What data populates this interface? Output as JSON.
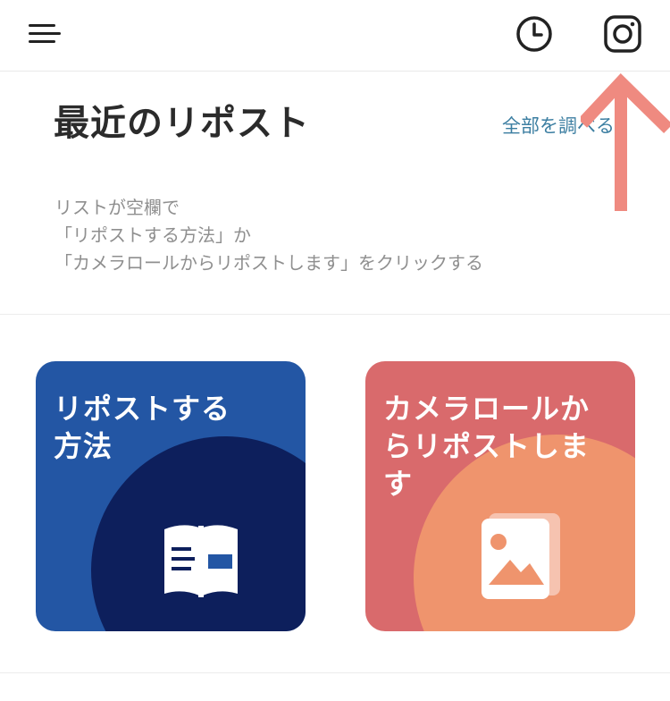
{
  "header": {
    "menu_icon": "hamburger-menu-icon",
    "history_icon": "clock-icon",
    "instagram_icon": "instagram-icon"
  },
  "recent": {
    "title": "最近のリポスト",
    "view_all": "全部を調べる",
    "empty_lines": [
      "リストが空欄で",
      "「リポストする方法」か",
      "「カメラロールからリポストします」をクリックする"
    ]
  },
  "cards": {
    "howto": {
      "title_lines": [
        "リポストする",
        "方法"
      ],
      "icon": "book-icon",
      "color": "#2356a4",
      "accent": "#0d1f5c"
    },
    "camera": {
      "title_lines": [
        "カメラロールか",
        "らリポストしま",
        "す"
      ],
      "icon": "image-icon",
      "color": "#d96a6c",
      "accent": "#ef946d"
    }
  },
  "annotation": {
    "arrow_color": "#ef8a80"
  }
}
